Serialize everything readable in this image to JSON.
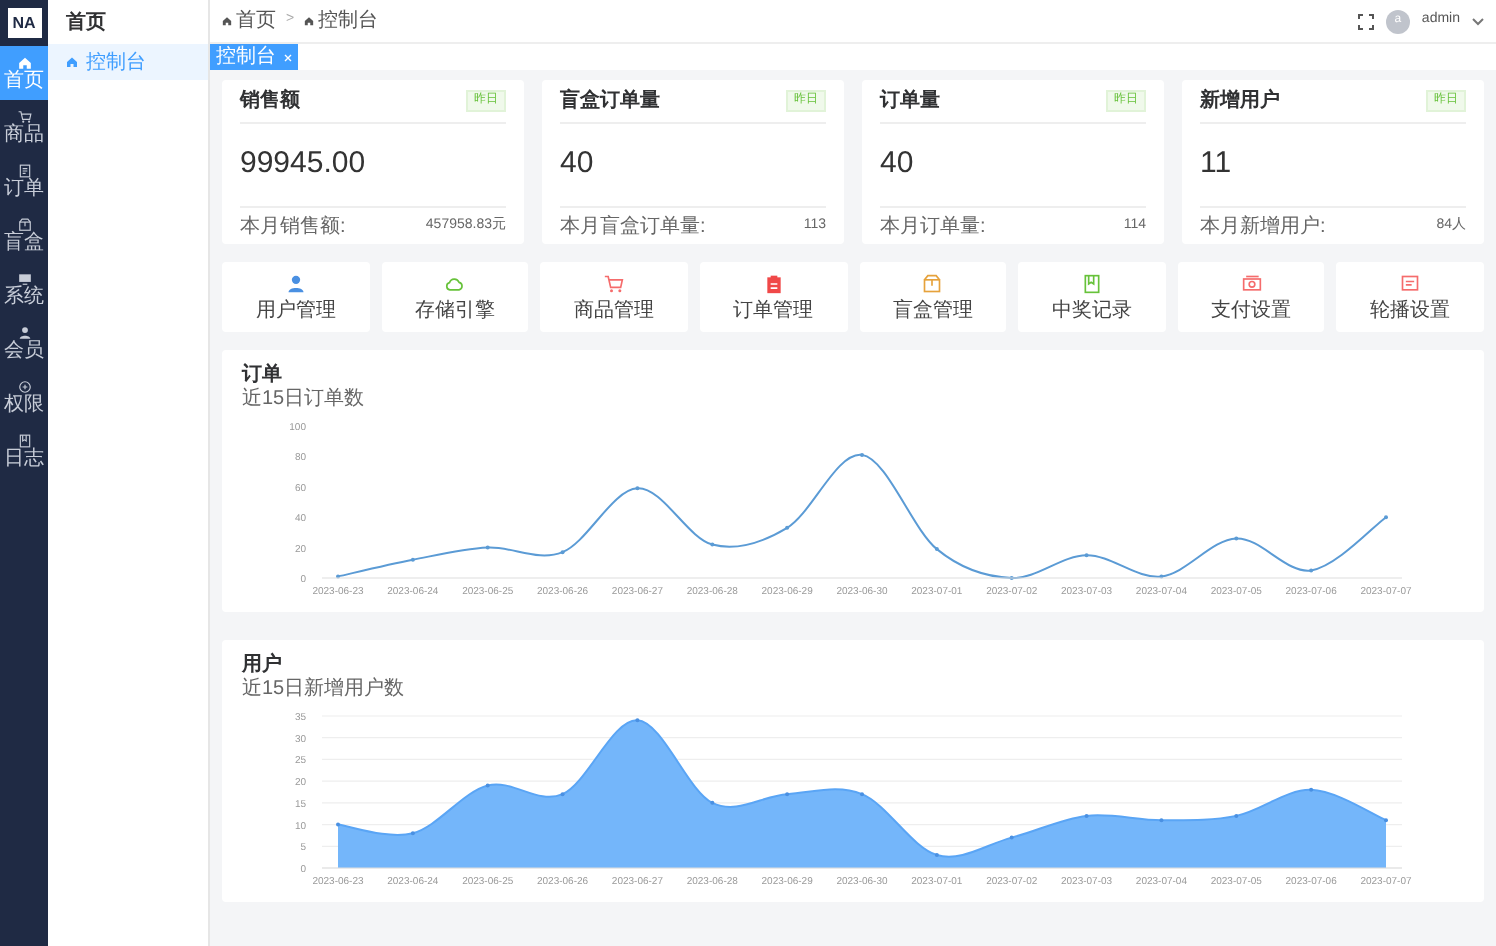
{
  "sidebar": {
    "logo": "NA",
    "items": [
      {
        "label": "首页",
        "kind": "home",
        "selected": true
      },
      {
        "label": "商品",
        "kind": "cart",
        "selected": false
      },
      {
        "label": "订单",
        "kind": "doc",
        "selected": false
      },
      {
        "label": "盲盒",
        "kind": "box",
        "selected": false
      },
      {
        "label": "系统",
        "kind": "monitor",
        "selected": false
      },
      {
        "label": "会员",
        "kind": "user",
        "selected": false
      },
      {
        "label": "权限",
        "kind": "shield",
        "selected": false
      },
      {
        "label": "日志",
        "kind": "book",
        "selected": false
      }
    ]
  },
  "submenu": {
    "title": "首页",
    "items": [
      {
        "label": "控制台",
        "selected": true
      }
    ]
  },
  "breadcrumb": [
    "首页",
    "控制台"
  ],
  "breadcrumb_separator": ">",
  "user": {
    "avatar": "a",
    "name": "admin"
  },
  "tabs": [
    {
      "label": "控制台",
      "selected": true
    }
  ],
  "stat_cards": [
    {
      "title": "销售额",
      "badge": "昨日",
      "value": "99945.00",
      "footer_label": "本月销售额:",
      "footer_value": "457958.83元"
    },
    {
      "title": "盲盒订单量",
      "badge": "昨日",
      "value": "40",
      "footer_label": "本月盲盒订单量:",
      "footer_value": "113"
    },
    {
      "title": "订单量",
      "badge": "昨日",
      "value": "40",
      "footer_label": "本月订单量:",
      "footer_value": "114"
    },
    {
      "title": "新增用户",
      "badge": "昨日",
      "value": "11",
      "footer_label": "本月新增用户:",
      "footer_value": "84人"
    }
  ],
  "shortcuts": [
    {
      "label": "用户管理",
      "kind": "user",
      "color": "#4a90e2"
    },
    {
      "label": "存储引擎",
      "kind": "cloud",
      "color": "#67c23a"
    },
    {
      "label": "商品管理",
      "kind": "cart",
      "color": "#f56c6c"
    },
    {
      "label": "订单管理",
      "kind": "clipboard",
      "color": "#f04848"
    },
    {
      "label": "盲盒管理",
      "kind": "box",
      "color": "#e6a23c"
    },
    {
      "label": "中奖记录",
      "kind": "book",
      "color": "#67c23a"
    },
    {
      "label": "支付设置",
      "kind": "money",
      "color": "#f56c6c"
    },
    {
      "label": "轮播设置",
      "kind": "message",
      "color": "#f56c6c"
    }
  ],
  "orders_panel": {
    "subtitle": "近15日订单数",
    "chart_data": {
      "type": "line",
      "title": "订单",
      "categories": [
        "2023-06-23",
        "2023-06-24",
        "2023-06-25",
        "2023-06-26",
        "2023-06-27",
        "2023-06-28",
        "2023-06-29",
        "2023-06-30",
        "2023-07-01",
        "2023-07-02",
        "2023-07-03",
        "2023-07-04",
        "2023-07-05",
        "2023-07-06",
        "2023-07-07"
      ],
      "series": [
        {
          "color": "#5b9bd5",
          "values": [
            1,
            12,
            20,
            17,
            59,
            22,
            33,
            81,
            19,
            0,
            15,
            1,
            26,
            5,
            40
          ]
        }
      ],
      "ylim": [
        0,
        100
      ],
      "yticks": [
        0,
        20,
        40,
        60,
        80,
        100
      ]
    }
  },
  "users_panel": {
    "subtitle": "近15日新增用户数",
    "chart_data": {
      "type": "area",
      "title": "用户",
      "categories": [
        "2023-06-23",
        "2023-06-24",
        "2023-06-25",
        "2023-06-26",
        "2023-06-27",
        "2023-06-28",
        "2023-06-29",
        "2023-06-30",
        "2023-07-01",
        "2023-07-02",
        "2023-07-03",
        "2023-07-04",
        "2023-07-05",
        "2023-07-06",
        "2023-07-07"
      ],
      "series": [
        {
          "color": "#74b6fa",
          "values": [
            10,
            8,
            19,
            17,
            34,
            15,
            17,
            17,
            3,
            7,
            12,
            11,
            12,
            18,
            11
          ]
        }
      ],
      "ylim": [
        0,
        35
      ],
      "yticks": [
        0,
        5,
        10,
        15,
        20,
        25,
        30,
        35
      ],
      "grid": true
    }
  }
}
